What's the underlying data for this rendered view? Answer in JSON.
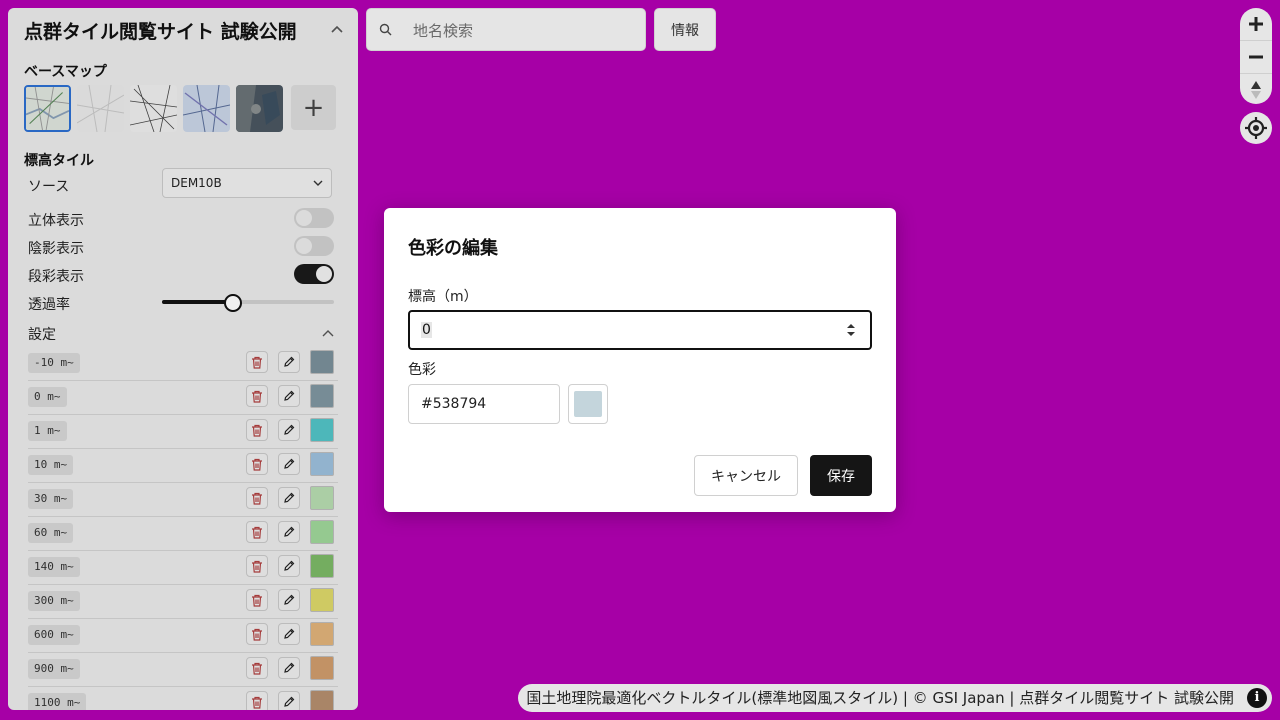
{
  "panel": {
    "title": "点群タイル閲覧サイト 試験公開",
    "basemap_label": "ベースマップ",
    "basemaps": [
      "standard-map-icon",
      "pale-map-icon",
      "blank-map-icon",
      "english-map-icon",
      "aerial-photo-icon"
    ],
    "add_label": "+",
    "elevation_label": "標高タイル",
    "source_label": "ソース",
    "source_value": "DEM10B",
    "toggles": [
      {
        "label": "立体表示",
        "on": false
      },
      {
        "label": "陰影表示",
        "on": false
      },
      {
        "label": "段彩表示",
        "on": true
      }
    ],
    "opacity_label": "透過率",
    "opacity_value": 0.41,
    "settings_label": "設定",
    "rows": [
      {
        "label": "-10 m~",
        "color": "#7a8f9a"
      },
      {
        "label": "0 m~",
        "color": "#7f95a0"
      },
      {
        "label": "1 m~",
        "color": "#52c3c6"
      },
      {
        "label": "10 m~",
        "color": "#9cbfdb"
      },
      {
        "label": "30 m~",
        "color": "#b6dbb0"
      },
      {
        "label": "60 m~",
        "color": "#9fd69a"
      },
      {
        "label": "140 m~",
        "color": "#7cb866"
      },
      {
        "label": "300 m~",
        "color": "#dcd76a"
      },
      {
        "label": "600 m~",
        "color": "#e0b27a"
      },
      {
        "label": "900 m~",
        "color": "#cf9c6c"
      },
      {
        "label": "1100 m~",
        "color": "#b48e6e"
      }
    ]
  },
  "search": {
    "placeholder": "地名検索"
  },
  "info_button": "情報",
  "attribution": {
    "text": "国土地理院最適化ベクトルタイル(標準地図風スタイル) | © GSI Japan | 点群タイル閲覧サイト 試験公開",
    "info_glyph": "i"
  },
  "modal": {
    "title": "色彩の編集",
    "elevation_label": "標高（m）",
    "elevation_value": "0",
    "color_label": "色彩",
    "color_value": "#538794",
    "preview_color": "#c4d5dc",
    "cancel_label": "キャンセル",
    "save_label": "保存"
  },
  "colors": {
    "background": "#a600a6",
    "accent": "#2c6fd1"
  }
}
